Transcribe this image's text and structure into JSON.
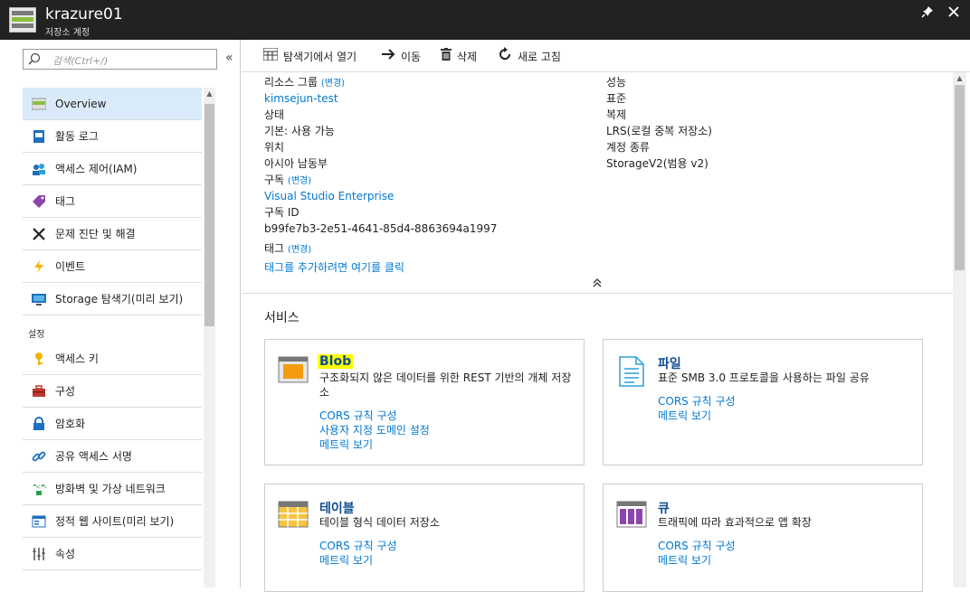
{
  "window": {
    "title": "krazure01",
    "subtitle": "저장소 계정"
  },
  "search": {
    "placeholder": "검색(Ctrl+/)"
  },
  "nav": {
    "items": [
      {
        "label": "Overview",
        "icon": "overview-icon",
        "active": true
      },
      {
        "label": "활동 로그",
        "icon": "activity-log-icon"
      },
      {
        "label": "액세스 제어(IAM)",
        "icon": "iam-icon"
      },
      {
        "label": "태그",
        "icon": "tag-icon"
      },
      {
        "label": "문제 진단 및 해결",
        "icon": "wrench-icon"
      },
      {
        "label": "이벤트",
        "icon": "lightning-icon"
      },
      {
        "label": "Storage 탐색기(미리 보기)",
        "icon": "storage-explorer-icon"
      }
    ],
    "section_settings": "설정",
    "settings_items": [
      {
        "label": "액세스 키",
        "icon": "key-icon"
      },
      {
        "label": "구성",
        "icon": "toolbox-icon"
      },
      {
        "label": "암호화",
        "icon": "lock-icon"
      },
      {
        "label": "공유 액세스 서명",
        "icon": "link-icon"
      },
      {
        "label": "방화벽 및 가상 네트워크",
        "icon": "firewall-icon"
      },
      {
        "label": "정적 웹 사이트(미리 보기)",
        "icon": "website-icon"
      },
      {
        "label": "속성",
        "icon": "properties-icon"
      }
    ]
  },
  "toolbar": {
    "open_explorer": "탐색기에서 열기",
    "move": "이동",
    "delete": "삭제",
    "refresh": "새로 고침"
  },
  "essentials": {
    "change": "(변경)",
    "resource_group_label": "리소스 그룹",
    "resource_group_value": "kimsejun-test",
    "status_label": "상태",
    "status_value": "기본: 사용 가능",
    "location_label": "위치",
    "location_value": "아시아 남동부",
    "subscription_label": "구독",
    "subscription_value": "Visual Studio Enterprise",
    "subscription_id_label": "구독 ID",
    "subscription_id_value": "b99fe7b3-2e51-4641-85d4-8863694a1997",
    "tags_label": "태그",
    "tags_value": "태그를 추가하려면 여기를 클릭",
    "performance_label": "성능",
    "performance_value": "표준",
    "replication_label": "복제",
    "replication_value": "LRS(로컬 중복 저장소)",
    "account_kind_label": "계정 종류",
    "account_kind_value": "StorageV2(범용 v2)"
  },
  "services": {
    "title": "서비스",
    "blob": {
      "title": "Blob",
      "desc": "구조화되지 않은 데이터를 위한 REST 기반의 개체 저장소",
      "links": [
        "CORS 규칙 구성",
        "사용자 지정 도메인 설정",
        "메트릭 보기"
      ]
    },
    "file": {
      "title": "파일",
      "desc": "표준 SMB 3.0 프로토콜을 사용하는 파일 공유",
      "links": [
        "CORS 규칙 구성",
        "메트릭 보기"
      ]
    },
    "table": {
      "title": "테이블",
      "desc": "테이블 형식 데이터 저장소",
      "links": [
        "CORS 규칙 구성",
        "메트릭 보기"
      ]
    },
    "queue": {
      "title": "큐",
      "desc": "트래픽에 따라 효과적으로 앱 확장",
      "links": [
        "CORS 규칙 구성",
        "메트릭 보기"
      ]
    }
  },
  "colors": {
    "accent": "#0078d4",
    "titlebar": "#222222",
    "highlight": "#ffff00",
    "active_nav": "#d9ebfa"
  }
}
